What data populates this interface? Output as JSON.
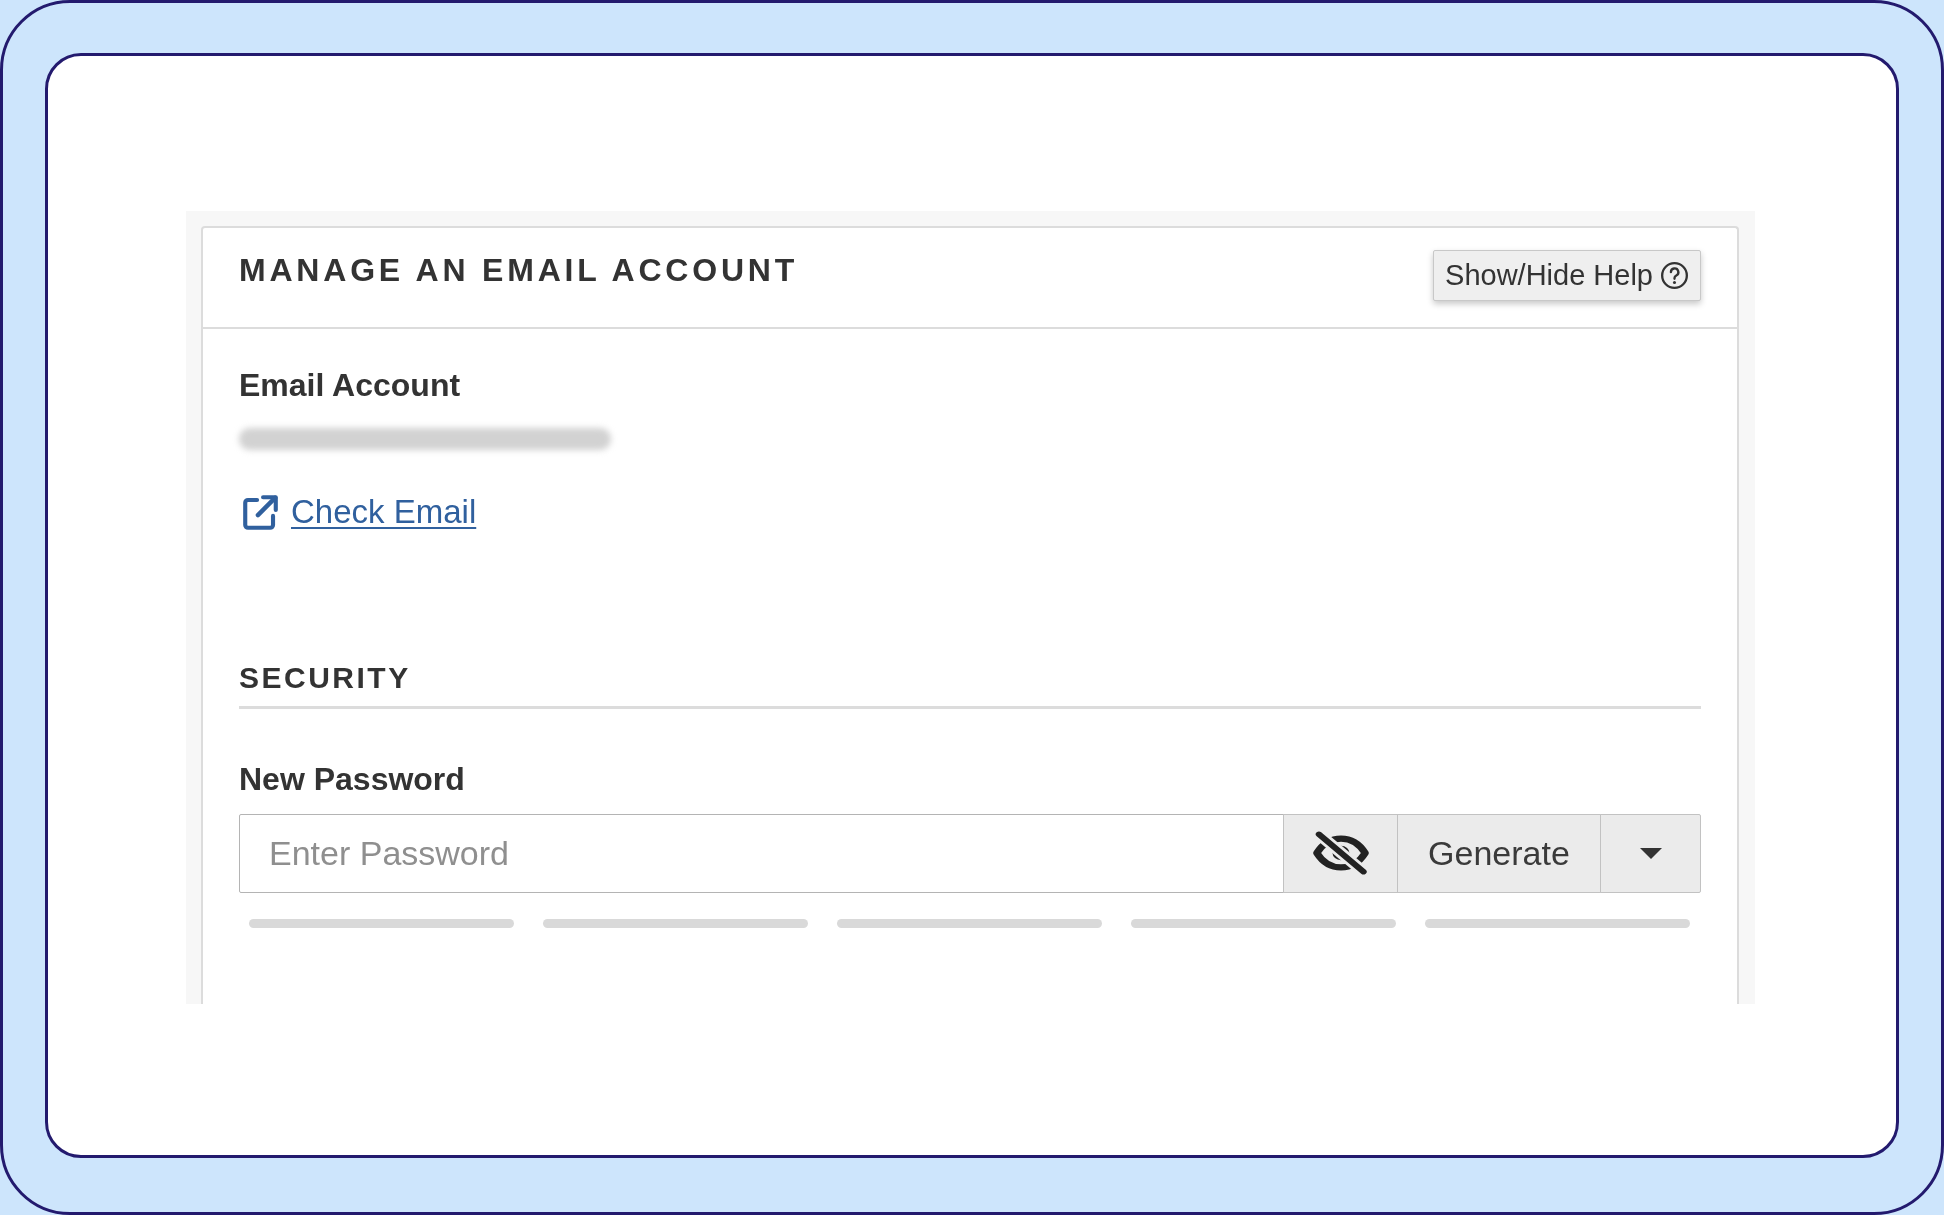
{
  "panel": {
    "title": "MANAGE AN EMAIL ACCOUNT",
    "help_button": {
      "label": "Show/Hide Help"
    }
  },
  "email_account": {
    "label": "Email Account",
    "address_redacted": true,
    "check_email_link": "Check Email"
  },
  "security": {
    "heading": "SECURITY",
    "new_password": {
      "label": "New Password",
      "placeholder": "Enter Password",
      "password_visible": false,
      "generate_button": "Generate",
      "strength_segments": [
        {
          "filled": false
        },
        {
          "filled": false
        },
        {
          "filled": false
        },
        {
          "filled": false
        },
        {
          "filled": false
        }
      ]
    }
  }
}
